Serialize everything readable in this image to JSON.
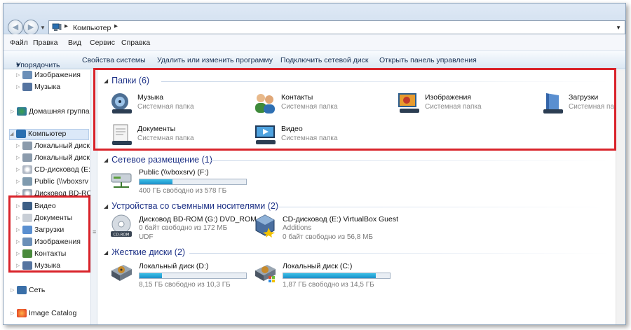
{
  "address": {
    "path": "Компьютер"
  },
  "menu": [
    "Файл",
    "Правка",
    "Вид",
    "Сервис",
    "Справка"
  ],
  "commands": {
    "organize": "Упорядочить",
    "organize_arrow": "▾",
    "items": [
      "Свойства системы",
      "Удалить или изменить программу",
      "Подключить сетевой диск",
      "Открыть панель управления"
    ]
  },
  "nav": {
    "top": [
      {
        "label": "Изображения"
      },
      {
        "label": "Музыка"
      }
    ],
    "homegroup": "Домашняя группа",
    "computer": "Компьютер",
    "drives": [
      {
        "label": "Локальный диск"
      },
      {
        "label": "Локальный диск"
      },
      {
        "label": "CD-дисковод (E:"
      },
      {
        "label": "Public (\\\\vboxsrv"
      },
      {
        "label": "Дисковод BD-RO"
      }
    ],
    "libraries": [
      {
        "label": "Видео"
      },
      {
        "label": "Документы"
      },
      {
        "label": "Загрузки"
      },
      {
        "label": "Изображения"
      },
      {
        "label": "Контакты"
      },
      {
        "label": "Музыка"
      }
    ],
    "network": "Сеть",
    "image_catalog": "Image Catalog"
  },
  "groups": {
    "folders": "Папки (6)",
    "network": "Сетевое размещение (1)",
    "removable": "Устройства со съемными носителями (2)",
    "hdd": "Жесткие диски (2)"
  },
  "folders": [
    {
      "name": "Музыка",
      "sub": "Системная папка",
      "icon": "music-folder-icon"
    },
    {
      "name": "Контакты",
      "sub": "Системная папка",
      "icon": "contacts-folder-icon"
    },
    {
      "name": "Изображения",
      "sub": "Системная папка",
      "icon": "pictures-folder-icon"
    },
    {
      "name": "Загрузки",
      "sub": "Системная папка",
      "icon": "downloads-folder-icon"
    },
    {
      "name": "Документы",
      "sub": "Системная папка",
      "icon": "documents-folder-icon"
    },
    {
      "name": "Видео",
      "sub": "Системная папка",
      "icon": "video-folder-icon"
    }
  ],
  "network_drive": {
    "name": "Public (\\\\vboxsrv) (F:)",
    "free": "400 ГБ свободно из 578 ГБ",
    "used_fraction": 0.31
  },
  "removable": [
    {
      "name": "Дисковод BD-ROM (G:) DVD_ROM",
      "line2": "0 байт свободно из 172 МБ",
      "line3": "UDF"
    },
    {
      "name": "CD-дисковод (E:) VirtualBox Guest",
      "line2": "Additions",
      "line3": "0 байт свободно из 56,8 МБ"
    }
  ],
  "hdd": [
    {
      "name": "Локальный диск (D:)",
      "free": "8,15 ГБ свободно из 10,3 ГБ",
      "used_fraction": 0.21
    },
    {
      "name": "Локальный диск (C:)",
      "free": "1,87 ГБ свободно из 14,5 ГБ",
      "used_fraction": 0.87
    }
  ]
}
